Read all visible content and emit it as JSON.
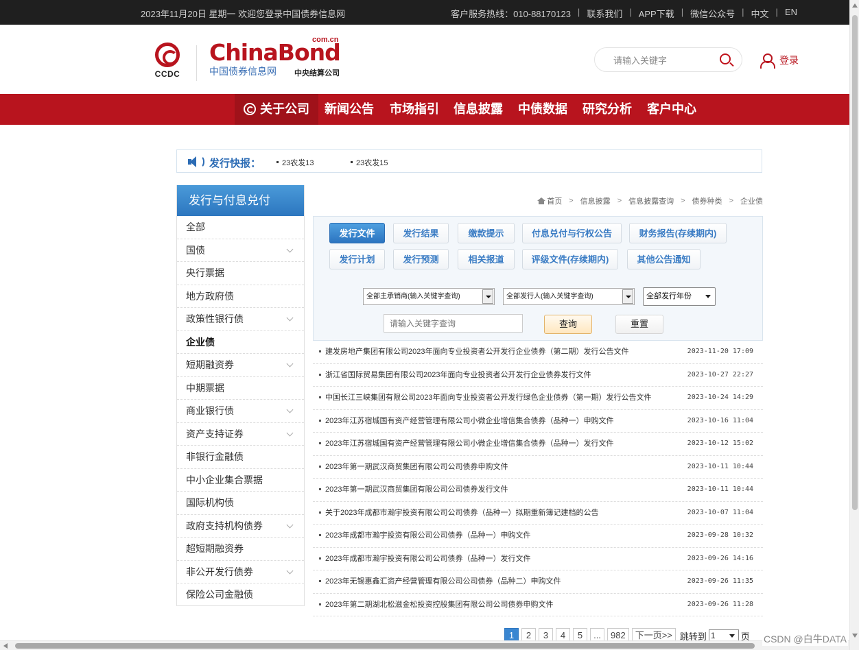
{
  "topbar": {
    "date_welcome": "2023年11月20日 星期一 欢迎您登录中国债券信息网",
    "links": [
      "客户服务热线：010-88170123",
      "联系我们",
      "APP下载",
      "微信公众号",
      "中文",
      "EN"
    ]
  },
  "header": {
    "ccdc_text": "CCDC",
    "logo_main": "ChinaBond",
    "logo_suffix": "com.cn",
    "logo_cn": "中国债券信息网",
    "logo_company": "中央结算公司",
    "search_placeholder": "请输入关键字",
    "login_label": "登录"
  },
  "nav": {
    "items": [
      "关于公司",
      "新闻公告",
      "市场指引",
      "信息披露",
      "中债数据",
      "研究分析",
      "客户中心"
    ]
  },
  "ticker": {
    "label": "发行快报：",
    "items": [
      "23农发13",
      "23农发15"
    ]
  },
  "sidebar": {
    "title": "发行与付息兑付",
    "items": [
      "全部",
      "国债",
      "央行票据",
      "地方政府债",
      "政策性银行债",
      "企业债",
      "短期融资券",
      "中期票据",
      "商业银行债",
      "资产支持证券",
      "非银行金融债",
      "中小企业集合票据",
      "国际机构债",
      "政府支持机构债券",
      "超短期融资券",
      "非公开发行债券",
      "保险公司金融债"
    ]
  },
  "breadcrumb": [
    "首页",
    "信息披露",
    "信息披露查询",
    "债券种类",
    "企业债"
  ],
  "filters": {
    "tabs_row1": [
      "发行文件",
      "发行结果",
      "缴款提示",
      "付息兑付与行权公告",
      "财务报告(存续期内)"
    ],
    "tabs_row2": [
      "发行计划",
      "发行预测",
      "相关报道",
      "评级文件(存续期内)",
      "其他公告通知"
    ],
    "underwriter_select": "全部主承销商(输入关键字查询)",
    "issuer_select": "全部发行人(输入关键字查询)",
    "year_select": "全部发行年份",
    "keyword_placeholder": "请输入关键字查询",
    "query_label": "查询",
    "reset_label": "重置"
  },
  "list": [
    {
      "title": "建发房地产集团有限公司2023年面向专业投资者公开发行企业债券（第二期）发行公告文件",
      "date": "2023-11-20 17:09"
    },
    {
      "title": "浙江省国际贸易集团有限公司2023年面向专业投资者公开发行企业债券发行文件",
      "date": "2023-10-27 22:27"
    },
    {
      "title": "中国长江三峡集团有限公司2023年面向专业投资者公开发行绿色企业债券（第一期）发行公告文件",
      "date": "2023-10-24 14:29"
    },
    {
      "title": "2023年江苏宿城国有资产经营管理有限公司小微企业增信集合债券（品种一）申购文件",
      "date": "2023-10-16 11:04"
    },
    {
      "title": "2023年江苏宿城国有资产经营管理有限公司小微企业增信集合债券（品种一）发行文件",
      "date": "2023-10-12 15:02"
    },
    {
      "title": "2023年第一期武汉商贸集团有限公司公司债券申购文件",
      "date": "2023-10-11 10:44"
    },
    {
      "title": "2023年第一期武汉商贸集团有限公司公司债券发行文件",
      "date": "2023-10-11 10:44"
    },
    {
      "title": "关于2023年成都市瀚宇投资有限公司公司债券（品种一）拟期重新簿记建档的公告",
      "date": "2023-10-07 11:04"
    },
    {
      "title": "2023年成都市瀚宇投资有限公司公司债券（品种一）申购文件",
      "date": "2023-09-28 10:32"
    },
    {
      "title": "2023年成都市瀚宇投资有限公司公司债券（品种一）发行文件",
      "date": "2023-09-26 14:16"
    },
    {
      "title": "2023年无锡惠鑫汇资产经营管理有限公司公司债券（品种二）申购文件",
      "date": "2023-09-26 11:35"
    },
    {
      "title": "2023年第二期湖北松滋金松投资控股集团有限公司公司债券申购文件",
      "date": "2023-09-26 11:28"
    }
  ],
  "pager": {
    "pages": [
      "1",
      "2",
      "3",
      "4",
      "5",
      "...",
      "982"
    ],
    "next_label": "下一页>>",
    "jump_label": "跳转到",
    "jump_value": "1",
    "page_suffix": "页"
  },
  "watermark": "CSDN @白牛DATA"
}
